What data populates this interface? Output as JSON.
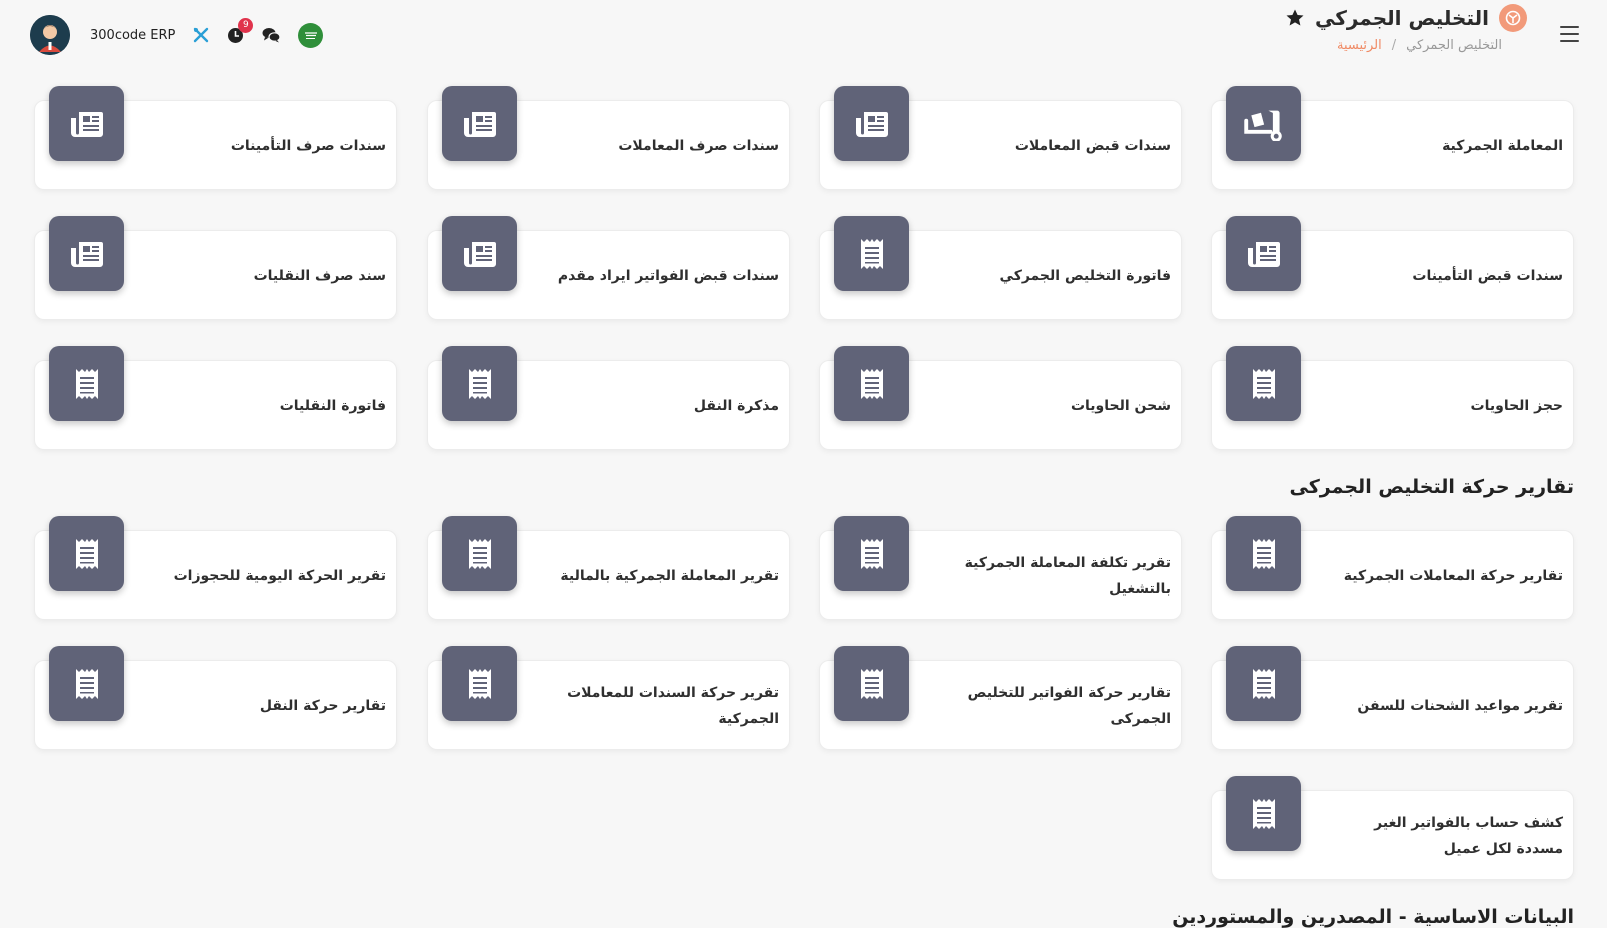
{
  "header": {
    "title": "التخليص الجمركي",
    "breadcrumb_home": "الرئيسية",
    "breadcrumb_sep": "/",
    "breadcrumb_current": "التخليص الجمركي",
    "app_name": "300code ERP",
    "notification_count": "9"
  },
  "cards": [
    {
      "label": "المعاملة الجمركية",
      "icon": "dolly-icon"
    },
    {
      "label": "سندات قبض المعاملات",
      "icon": "newspaper-icon"
    },
    {
      "label": "سندات صرف المعاملات",
      "icon": "newspaper-icon"
    },
    {
      "label": "سندات صرف التأمينات",
      "icon": "newspaper-icon"
    },
    {
      "label": "سندات قبض التأمينات",
      "icon": "newspaper-icon"
    },
    {
      "label": "فاتورة التخليص الجمركي",
      "icon": "receipt-icon"
    },
    {
      "label": "سندات قبض الفواتير ايراد مقدم",
      "icon": "newspaper-icon"
    },
    {
      "label": "سند صرف النقليات",
      "icon": "newspaper-icon"
    },
    {
      "label": "حجز الحاويات",
      "icon": "receipt-icon"
    },
    {
      "label": "شحن الحاويات",
      "icon": "receipt-icon"
    },
    {
      "label": "مذكرة النقل",
      "icon": "receipt-icon"
    },
    {
      "label": "فاتورة النقليات",
      "icon": "receipt-icon"
    }
  ],
  "reports_section": {
    "title": "تقارير حركة التخليص الجمركى",
    "cards": [
      {
        "label": "تقارير حركة المعاملات الجمركية",
        "icon": "receipt-icon"
      },
      {
        "label": "تقرير تكلفة المعاملة الجمركية بالتشغيل",
        "icon": "receipt-icon"
      },
      {
        "label": "تقرير المعاملة الجمركية بالمالية",
        "icon": "receipt-icon"
      },
      {
        "label": "تقرير الحركة اليومية للحجوزات",
        "icon": "receipt-icon"
      },
      {
        "label": "تقرير مواعيد الشحنات للسفن",
        "icon": "receipt-icon"
      },
      {
        "label": "تقارير حركة الفواتير للتخليص الجمركى",
        "icon": "receipt-icon"
      },
      {
        "label": "تقرير حركة السندات للمعاملات الجمركية",
        "icon": "receipt-icon"
      },
      {
        "label": "تقارير حركة النقل",
        "icon": "receipt-icon"
      },
      {
        "label": "كشف حساب بالفواتير الغير مسددة لكل عميل",
        "icon": "receipt-icon"
      }
    ]
  },
  "master_data_section": {
    "title": "البيانات الاساسية - المصدرين والمستوردين"
  },
  "colors": {
    "tile": "#606378",
    "accent": "#f08a64",
    "badge": "#e0334c",
    "background": "#f7f7f7"
  }
}
